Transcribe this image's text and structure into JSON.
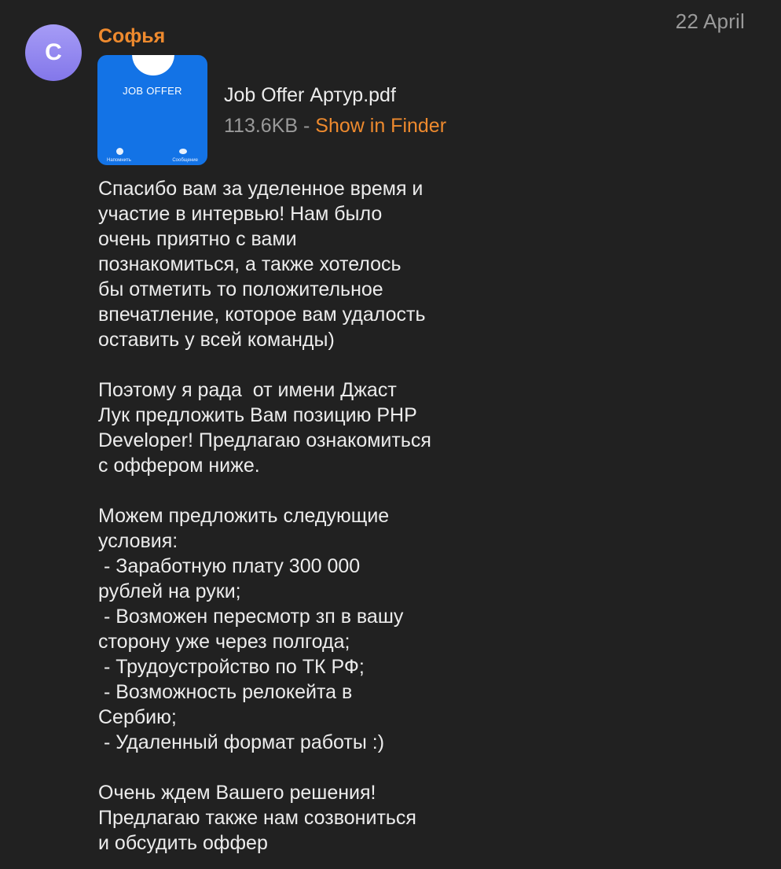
{
  "date": "22 April",
  "avatar": {
    "initial": "C",
    "color": "#9085f0"
  },
  "sender": {
    "name": "Софья",
    "color": "#ee8a2e"
  },
  "attachment": {
    "thumbnail": {
      "title": "JOB OFFER",
      "left_label": "Напомнить",
      "right_label": "Сообщение",
      "color": "#1373e6"
    },
    "file_name": "Job Offer Артур.pdf",
    "file_size": "113.6KB",
    "separator": " - ",
    "action_label": "Show in Finder"
  },
  "message": {
    "lines": [
      "Спасибо вам за уделенное время и",
      "участие в интервью! Нам было",
      "очень приятно с вами",
      "познакомиться, а также хотелось",
      "бы отметить то положительное",
      "впечатление, которое вам удалость",
      "оставить у всей команды)",
      "",
      "Поэтому я рада  от имени Джаст",
      "Лук предложить Вам позицию PHP",
      "Developer! Предлагаю ознакомиться",
      "с оффером ниже.",
      "",
      "Можем предложить следующие",
      "условия:",
      " - Заработную плату 300 000",
      "рублей на руки;",
      " - Возможен пересмотр зп в вашу",
      "сторону уже через полгода;",
      " - Трудоустройство по ТК РФ;",
      " - Возможность релокейта в",
      "Сербию;",
      " - Удаленный формат работы :)",
      "",
      "Очень ждем Вашего решения!",
      "Предлагаю также нам созвониться",
      "и обсудить оффер"
    ]
  }
}
